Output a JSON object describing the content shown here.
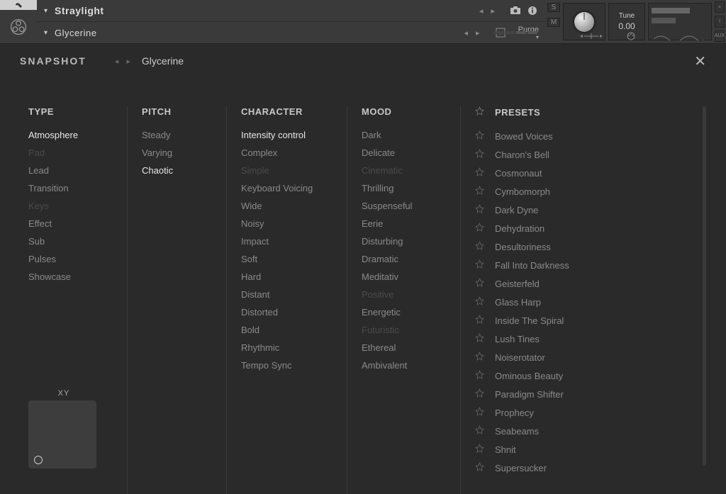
{
  "header": {
    "instrument_name": "Straylight",
    "snapshot_name": "Glycerine",
    "purge_label": "Purge",
    "tune_label": "Tune",
    "tune_value": "0.00",
    "solo_label": "S",
    "mute_label": "M",
    "end_buttons": [
      "×",
      "!",
      "AUX"
    ]
  },
  "snapshot": {
    "section_label": "SNAPSHOT",
    "current": "Glycerine"
  },
  "columns": {
    "type": {
      "title": "TYPE",
      "items": [
        {
          "label": "Atmosphere",
          "state": "selected"
        },
        {
          "label": "Pad",
          "state": "dim"
        },
        {
          "label": "Lead",
          "state": "normal"
        },
        {
          "label": "Transition",
          "state": "normal"
        },
        {
          "label": "Keys",
          "state": "dim"
        },
        {
          "label": "Effect",
          "state": "normal"
        },
        {
          "label": "Sub",
          "state": "normal"
        },
        {
          "label": "Pulses",
          "state": "normal"
        },
        {
          "label": "Showcase",
          "state": "normal"
        }
      ]
    },
    "pitch": {
      "title": "PITCH",
      "items": [
        {
          "label": "Steady",
          "state": "normal"
        },
        {
          "label": "Varying",
          "state": "normal"
        },
        {
          "label": "Chaotic",
          "state": "selected"
        }
      ]
    },
    "character": {
      "title": "CHARACTER",
      "items": [
        {
          "label": "Intensity control",
          "state": "selected"
        },
        {
          "label": "Complex",
          "state": "normal"
        },
        {
          "label": "Simple",
          "state": "dim"
        },
        {
          "label": "Keyboard Voicing",
          "state": "normal"
        },
        {
          "label": "Wide",
          "state": "normal"
        },
        {
          "label": "Noisy",
          "state": "normal"
        },
        {
          "label": "Impact",
          "state": "normal"
        },
        {
          "label": "Soft",
          "state": "normal"
        },
        {
          "label": "Hard",
          "state": "normal"
        },
        {
          "label": "Distant",
          "state": "normal"
        },
        {
          "label": "Distorted",
          "state": "normal"
        },
        {
          "label": "Bold",
          "state": "normal"
        },
        {
          "label": "Rhythmic",
          "state": "normal"
        },
        {
          "label": "Tempo Sync",
          "state": "normal"
        }
      ]
    },
    "mood": {
      "title": "MOOD",
      "items": [
        {
          "label": "Dark",
          "state": "normal"
        },
        {
          "label": "Delicate",
          "state": "normal"
        },
        {
          "label": "Cinematic",
          "state": "dim"
        },
        {
          "label": "Thrilling",
          "state": "normal"
        },
        {
          "label": "Suspenseful",
          "state": "normal"
        },
        {
          "label": "Eerie",
          "state": "normal"
        },
        {
          "label": "Disturbing",
          "state": "normal"
        },
        {
          "label": "Dramatic",
          "state": "normal"
        },
        {
          "label": "Meditativ",
          "state": "normal"
        },
        {
          "label": "Positive",
          "state": "dim"
        },
        {
          "label": "Energetic",
          "state": "normal"
        },
        {
          "label": "Futuristic",
          "state": "dim"
        },
        {
          "label": "Ethereal",
          "state": "normal"
        },
        {
          "label": "Ambivalent",
          "state": "normal"
        }
      ]
    },
    "presets": {
      "title": "PRESETS",
      "items": [
        "Bowed Voices",
        "Charon's Bell",
        "Cosmonaut",
        "Cymbomorph",
        "Dark Dyne",
        "Dehydration",
        "Desultoriness",
        "Fall Into Darkness",
        "Geisterfeld",
        "Glass Harp",
        "Inside The Spiral",
        "Lush Tines",
        "Noiserotator",
        "Ominous Beauty",
        "Paradigm Shifter",
        "Prophecy",
        "Seabeams",
        "Shnit",
        "Supersucker"
      ]
    }
  },
  "xy": {
    "label": "XY"
  }
}
